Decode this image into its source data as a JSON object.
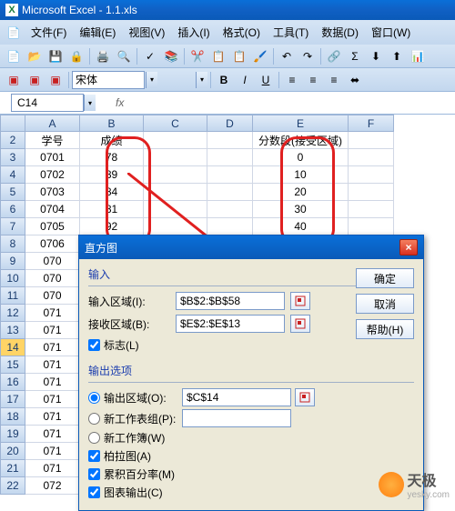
{
  "app": {
    "title": "Microsoft Excel - 1.1.xls"
  },
  "menu": {
    "file": "文件(F)",
    "edit": "编辑(E)",
    "view": "视图(V)",
    "insert": "插入(I)",
    "format": "格式(O)",
    "tools": "工具(T)",
    "data": "数据(D)",
    "window": "窗口(W)"
  },
  "font": {
    "name": "宋体"
  },
  "namebox": "C14",
  "fx": "fx",
  "columns": [
    "A",
    "B",
    "C",
    "D",
    "E",
    "F"
  ],
  "rows": [
    {
      "n": 2,
      "A": "学号",
      "B": "成绩",
      "E": "分数段(接受区域)"
    },
    {
      "n": 3,
      "A": "0701",
      "B": "78",
      "E": "0"
    },
    {
      "n": 4,
      "A": "0702",
      "B": "89",
      "E": "10"
    },
    {
      "n": 5,
      "A": "0703",
      "B": "84",
      "E": "20"
    },
    {
      "n": 6,
      "A": "0704",
      "B": "81",
      "E": "30"
    },
    {
      "n": 7,
      "A": "0705",
      "B": "92",
      "E": "40"
    },
    {
      "n": 8,
      "A": "0706"
    },
    {
      "n": 9,
      "A": "070"
    },
    {
      "n": 10,
      "A": "070"
    },
    {
      "n": 11,
      "A": "070"
    },
    {
      "n": 12,
      "A": "071"
    },
    {
      "n": 13,
      "A": "071"
    },
    {
      "n": 14,
      "A": "071"
    },
    {
      "n": 15,
      "A": "071"
    },
    {
      "n": 16,
      "A": "071"
    },
    {
      "n": 17,
      "A": "071"
    },
    {
      "n": 18,
      "A": "071"
    },
    {
      "n": 19,
      "A": "071"
    },
    {
      "n": 20,
      "A": "071"
    },
    {
      "n": 21,
      "A": "071"
    },
    {
      "n": 22,
      "A": "072"
    }
  ],
  "dialog": {
    "title": "直方图",
    "group_input": "输入",
    "input_range_label": "输入区域(I):",
    "input_range_value": "$B$2:$B$58",
    "bin_range_label": "接收区域(B):",
    "bin_range_value": "$E$2:$E$13",
    "labels_chk": "标志(L)",
    "group_output": "输出选项",
    "output_range_label": "输出区域(O):",
    "output_range_value": "$C$14",
    "new_sheet_label": "新工作表组(P):",
    "new_book_label": "新工作簿(W)",
    "pareto_label": "柏拉图(A)",
    "cumulative_label": "累积百分率(M)",
    "chart_label": "图表输出(C)",
    "ok": "确定",
    "cancel": "取消",
    "help": "帮助(H)"
  },
  "watermark": {
    "text": "天极",
    "url": "yesky.com"
  }
}
